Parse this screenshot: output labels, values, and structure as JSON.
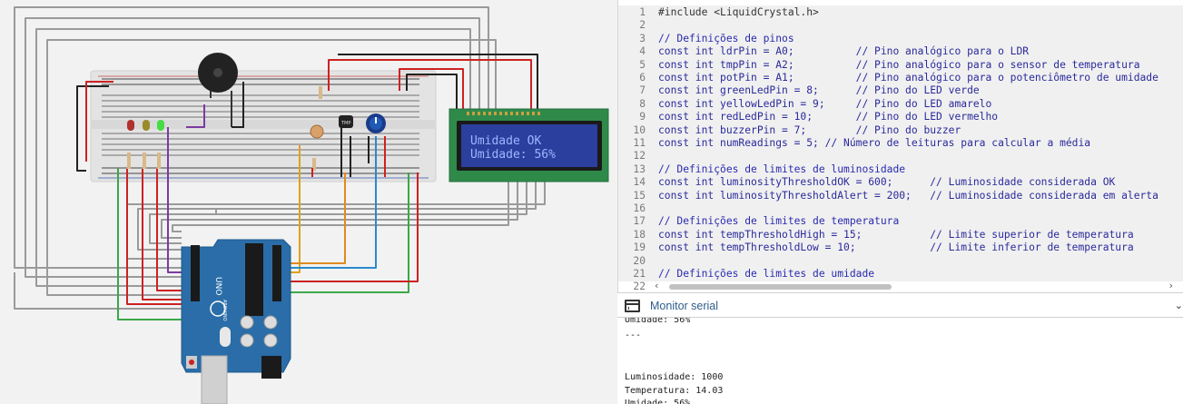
{
  "canvas": {
    "lcd": {
      "line1": "Umidade OK",
      "line2": "Umidade: 56%",
      "bg_color": "#2a3f9e",
      "text_color": "#9db6ff"
    },
    "board": {
      "name": "UNO",
      "brand": "ARDUINO",
      "color": "#2a6da8"
    },
    "sensor_label": "TMP"
  },
  "editor": {
    "lines": [
      {
        "n": "1",
        "text": "#include <LiquidCrystal.h>",
        "kind": "plain"
      },
      {
        "n": "2",
        "text": "",
        "kind": "plain"
      },
      {
        "n": "3",
        "text": "// Definições de pinos",
        "kind": "comment"
      },
      {
        "n": "4",
        "text": "const int ldrPin = A0;          // Pino analógico para o LDR",
        "kind": "code"
      },
      {
        "n": "5",
        "text": "const int tmpPin = A2;          // Pino analógico para o sensor de temperatura",
        "kind": "code"
      },
      {
        "n": "6",
        "text": "const int potPin = A1;          // Pino analógico para o potenciômetro de umidade",
        "kind": "code"
      },
      {
        "n": "7",
        "text": "const int greenLedPin = 8;      // Pino do LED verde",
        "kind": "code"
      },
      {
        "n": "8",
        "text": "const int yellowLedPin = 9;     // Pino do LED amarelo",
        "kind": "code"
      },
      {
        "n": "9",
        "text": "const int redLedPin = 10;       // Pino do LED vermelho",
        "kind": "code"
      },
      {
        "n": "10",
        "text": "const int buzzerPin = 7;        // Pino do buzzer",
        "kind": "code"
      },
      {
        "n": "11",
        "text": "const int numReadings = 5; // Número de leituras para calcular a média",
        "kind": "code"
      },
      {
        "n": "12",
        "text": "",
        "kind": "plain"
      },
      {
        "n": "13",
        "text": "// Definições de limites de luminosidade",
        "kind": "comment"
      },
      {
        "n": "14",
        "text": "const int luminosityThresholdOK = 600;      // Luminosidade considerada OK",
        "kind": "code"
      },
      {
        "n": "15",
        "text": "const int luminosityThresholdAlert = 200;   // Luminosidade considerada em alerta",
        "kind": "code"
      },
      {
        "n": "16",
        "text": "",
        "kind": "plain"
      },
      {
        "n": "17",
        "text": "// Definições de limites de temperatura",
        "kind": "comment"
      },
      {
        "n": "18",
        "text": "const int tempThresholdHigh = 15;           // Limite superior de temperatura",
        "kind": "code"
      },
      {
        "n": "19",
        "text": "const int tempThresholdLow = 10;            // Limite inferior de temperatura",
        "kind": "code"
      },
      {
        "n": "20",
        "text": "",
        "kind": "plain"
      },
      {
        "n": "21",
        "text": "// Definições de limites de umidade",
        "kind": "comment"
      },
      {
        "n": "22",
        "text": "",
        "kind": "plain"
      }
    ]
  },
  "serial_monitor": {
    "title": "Monitor serial",
    "lines": [
      "Umidade: 56%",
      "---",
      "",
      "Luminosidade: 1000",
      "Temperatura: 14.03",
      "Umidade: 56%",
      "---"
    ]
  },
  "icons": {
    "monitor": "serial-monitor-icon",
    "scroll_left": "chevron-left-icon",
    "scroll_right": "chevron-right-icon",
    "collapse": "chevron-down-icon"
  }
}
